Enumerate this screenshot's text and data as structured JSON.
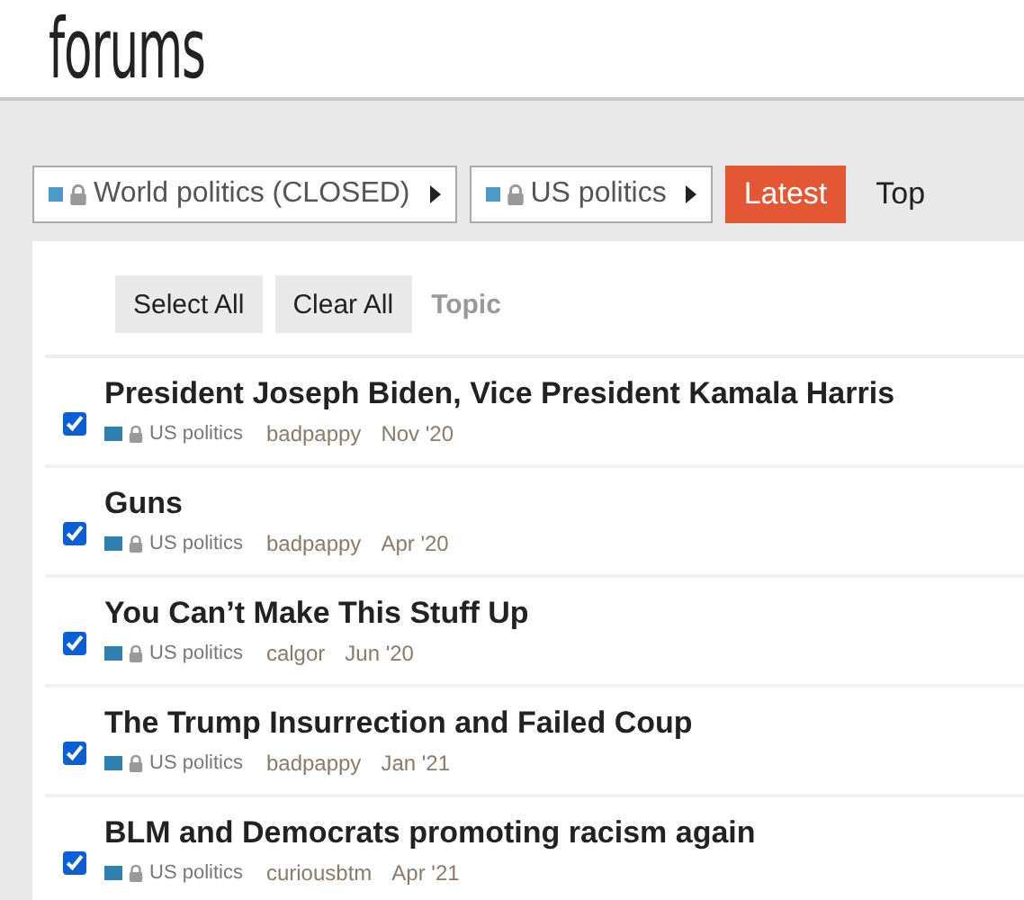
{
  "logo": "forums",
  "nav": {
    "categories": [
      {
        "name": "World politics (CLOSED)",
        "color": "#4a9bc9",
        "locked": true
      },
      {
        "name": "US politics",
        "color": "#4a9bc9",
        "locked": true
      }
    ],
    "tabs": [
      {
        "label": "Latest",
        "selected": true
      },
      {
        "label": "Top",
        "selected": false
      }
    ]
  },
  "bulk": {
    "buttons": [
      "Select All",
      "Clear All"
    ],
    "column": "Topic"
  },
  "topics": [
    {
      "title": "President Joseph Biden, Vice President Kamala Harris",
      "category": "US politics",
      "color": "#2f7fb0",
      "locked": true,
      "author": "badpappy",
      "date": "Nov '20",
      "checked": true
    },
    {
      "title": "Guns",
      "category": "US politics",
      "color": "#2f7fb0",
      "locked": true,
      "author": "badpappy",
      "date": "Apr '20",
      "checked": true
    },
    {
      "title": "You Can’t Make This Stuff Up",
      "category": "US politics",
      "color": "#2f7fb0",
      "locked": true,
      "author": "calgor",
      "date": "Jun '20",
      "checked": true
    },
    {
      "title": "The Trump Insurrection and Failed Coup",
      "category": "US politics",
      "color": "#2f7fb0",
      "locked": true,
      "author": "badpappy",
      "date": "Jan '21",
      "checked": true
    },
    {
      "title": "BLM and Democrats promoting racism again",
      "category": "US politics",
      "color": "#2f7fb0",
      "locked": true,
      "author": "curiousbtm",
      "date": "Apr '21",
      "checked": true
    }
  ]
}
